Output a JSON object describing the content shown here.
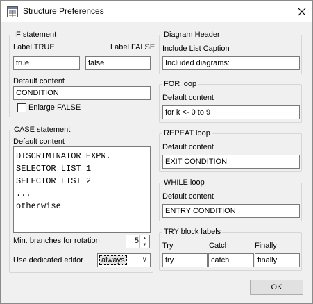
{
  "window": {
    "title": "Structure Preferences"
  },
  "if_statement": {
    "legend": "IF statement",
    "label_true": "Label TRUE",
    "label_false": "Label FALSE",
    "true_value": "true",
    "false_value": "false",
    "default_content_label": "Default content",
    "default_content": "CONDITION",
    "enlarge_false_label": "Enlarge FALSE",
    "enlarge_false_checked": false
  },
  "case_statement": {
    "legend": "CASE statement",
    "default_content_label": "Default content",
    "lines": [
      "DISCRIMINATOR EXPR.",
      "SELECTOR LIST 1",
      "SELECTOR LIST 2",
      "...",
      "otherwise"
    ],
    "min_branches_label": "Min. branches for rotation",
    "min_branches_value": "5",
    "editor_label": "Use dedicated editor",
    "editor_value": "always"
  },
  "diagram_header": {
    "legend": "Diagram Header",
    "caption_label": "Include List Caption",
    "caption_value": "Included diagrams:"
  },
  "for_loop": {
    "legend": "FOR loop",
    "default_content_label": "Default content",
    "default_content": "for k <- 0 to 9"
  },
  "repeat_loop": {
    "legend": "REPEAT loop",
    "default_content_label": "Default content",
    "default_content": "EXIT CONDITION"
  },
  "while_loop": {
    "legend": "WHILE loop",
    "default_content_label": "Default content",
    "default_content": "ENTRY CONDITION"
  },
  "try_block": {
    "legend": "TRY block labels",
    "try_label": "Try",
    "catch_label": "Catch",
    "finally_label": "Finally",
    "try_value": "try",
    "catch_value": "catch",
    "finally_value": "finally"
  },
  "buttons": {
    "ok": "OK"
  }
}
